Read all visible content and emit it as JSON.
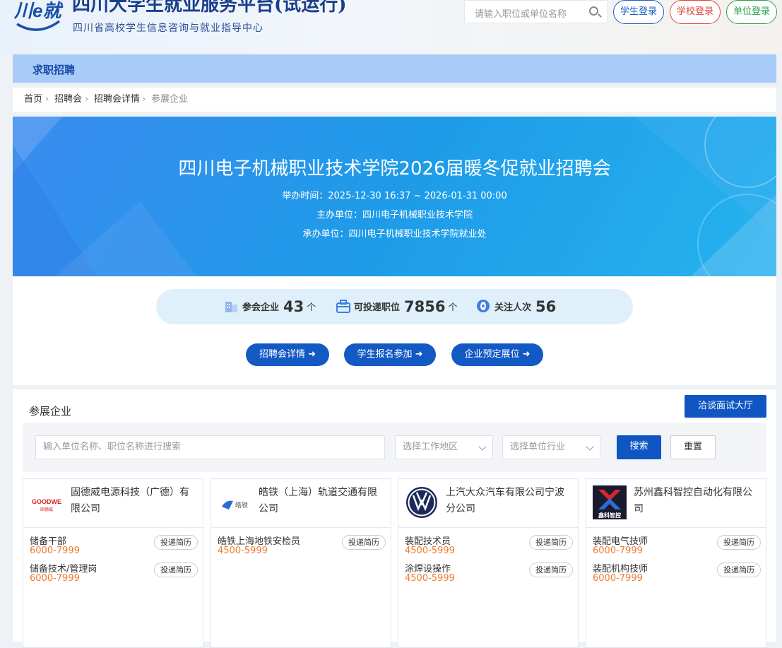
{
  "header": {
    "logo_text": "川e就",
    "site_title": "四川大学生就业服务平台(试运行)",
    "site_subtitle": "四川省高校学生信息咨询与就业指导中心",
    "search_placeholder": "请输入职位或单位名称",
    "login_buttons": [
      {
        "label": "学生登录",
        "color": "#1a5fc4"
      },
      {
        "label": "学校登录",
        "color": "#e0453a"
      },
      {
        "label": "单位登录",
        "color": "#2aa14a"
      }
    ]
  },
  "nav": {
    "active": "求职招聘"
  },
  "breadcrumb": [
    "首页",
    "招聘会",
    "招聘会详情",
    "参展企业"
  ],
  "banner": {
    "title": "四川电子机械职业技术学院2026届暖冬促就业招聘会",
    "time": "举办时间：2025-12-30 16:37 ~ 2026-01-31 00:00",
    "organizer": "主办单位：四川电子机械职业技术学院",
    "undertaker": "承办单位：四川电子机械职业技术学院就业处"
  },
  "stats": [
    {
      "label": "参会企业",
      "value": "43",
      "unit": "个",
      "icon": "building-icon"
    },
    {
      "label": "可投递职位",
      "value": "7856",
      "unit": "个",
      "icon": "briefcase-icon"
    },
    {
      "label": "关注人次",
      "value": "56",
      "unit": "",
      "icon": "eye-icon"
    }
  ],
  "actions": [
    "招聘会详情 ➜",
    "学生报名参加 ➜",
    "企业预定展位 ➜"
  ],
  "section": {
    "title": "参展企业",
    "hall_button": "洽谈面试大厅",
    "search_placeholder": "输入单位名称、职位名称进行搜索",
    "region_placeholder": "选择工作地区",
    "industry_placeholder": "选择单位行业",
    "search_button": "搜索",
    "reset_button": "重置"
  },
  "companies": [
    {
      "name": "固德威电源科技（广德）有限公司",
      "logo": "GOODWE",
      "logo_sub": "固德威",
      "jobs": [
        {
          "title": "储备干部",
          "salary": "6000-7999"
        },
        {
          "title": "储备技术/管理岗",
          "salary": "6000-7999"
        }
      ]
    },
    {
      "name": "皓铁（上海）轨道交通有限公司",
      "logo": "皓铁",
      "jobs": [
        {
          "title": "皓铁上海地铁安检员",
          "salary": "4500-5999"
        }
      ]
    },
    {
      "name": "上汽大众汽车有限公司宁波分公司",
      "logo": "VW",
      "jobs": [
        {
          "title": "装配技术员",
          "salary": "4500-5999"
        },
        {
          "title": "涂焊设操作",
          "salary": "4500-5999"
        }
      ]
    },
    {
      "name": "苏州鑫科智控自动化有限公司",
      "logo": "鑫科智控",
      "jobs": [
        {
          "title": "装配电气技师",
          "salary": "6000-7999"
        },
        {
          "title": "装配机构技师",
          "salary": "6000-7999"
        }
      ]
    }
  ],
  "apply_label": "投递简历",
  "colors": {
    "primary": "#1359c4",
    "salary": "#ee7a2f",
    "nav": "#a9cbf8"
  }
}
